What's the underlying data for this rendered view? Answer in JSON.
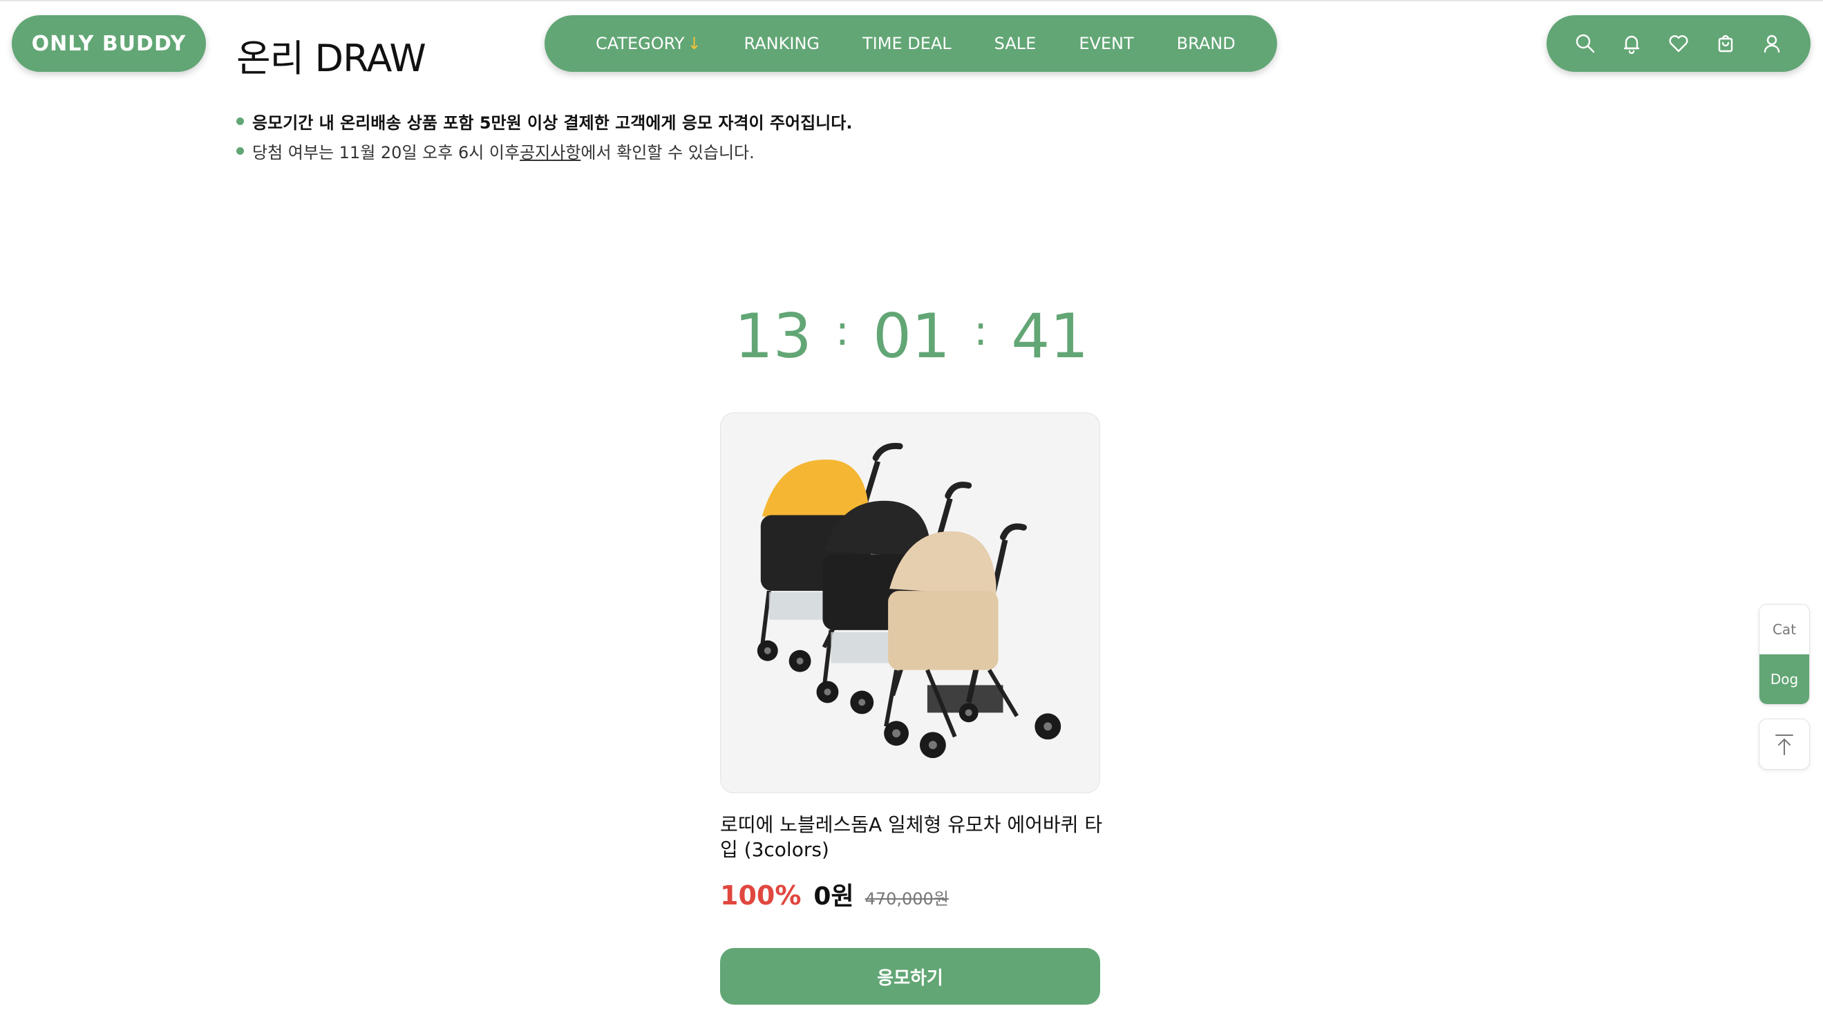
{
  "header": {
    "logo": "ONLY BUDDY",
    "page_title": "온리 DRAW",
    "nav": {
      "category": "CATEGORY",
      "ranking": "RANKING",
      "time_deal": "TIME DEAL",
      "sale": "SALE",
      "event": "EVENT",
      "brand": "BRAND"
    },
    "icons": [
      "search-icon",
      "bell-icon",
      "heart-icon",
      "cart-icon",
      "user-icon"
    ]
  },
  "notices": {
    "line1": "응모기간 내 온리배송 상품 포함 5만원 이상 결제한 고객에게 응모 자격이 주어집니다.",
    "line2_before": "당첨 여부는 11월 20일 오후 6시 이후 ",
    "line2_link": "공지사항",
    "line2_after": "에서 확인할 수 있습니다."
  },
  "countdown": {
    "hours": "13",
    "minutes": "01",
    "seconds": "41",
    "separator": ":"
  },
  "product": {
    "name": "로띠에 노블레스돔A 일체형 유모차 에어바퀴 타입 (3colors)",
    "discount": "100%",
    "sale_price": "0원",
    "original_price": "470,000원",
    "colors": [
      "#f5b733",
      "#1f1f1f",
      "#e6cfae"
    ]
  },
  "apply_button": "응모하기",
  "side": {
    "cat": "Cat",
    "dog": "Dog",
    "selected": "Dog"
  },
  "theme": {
    "accent": "#63a675",
    "discount_color": "#e0473e",
    "nav_arrow_color": "#f3c13a"
  }
}
